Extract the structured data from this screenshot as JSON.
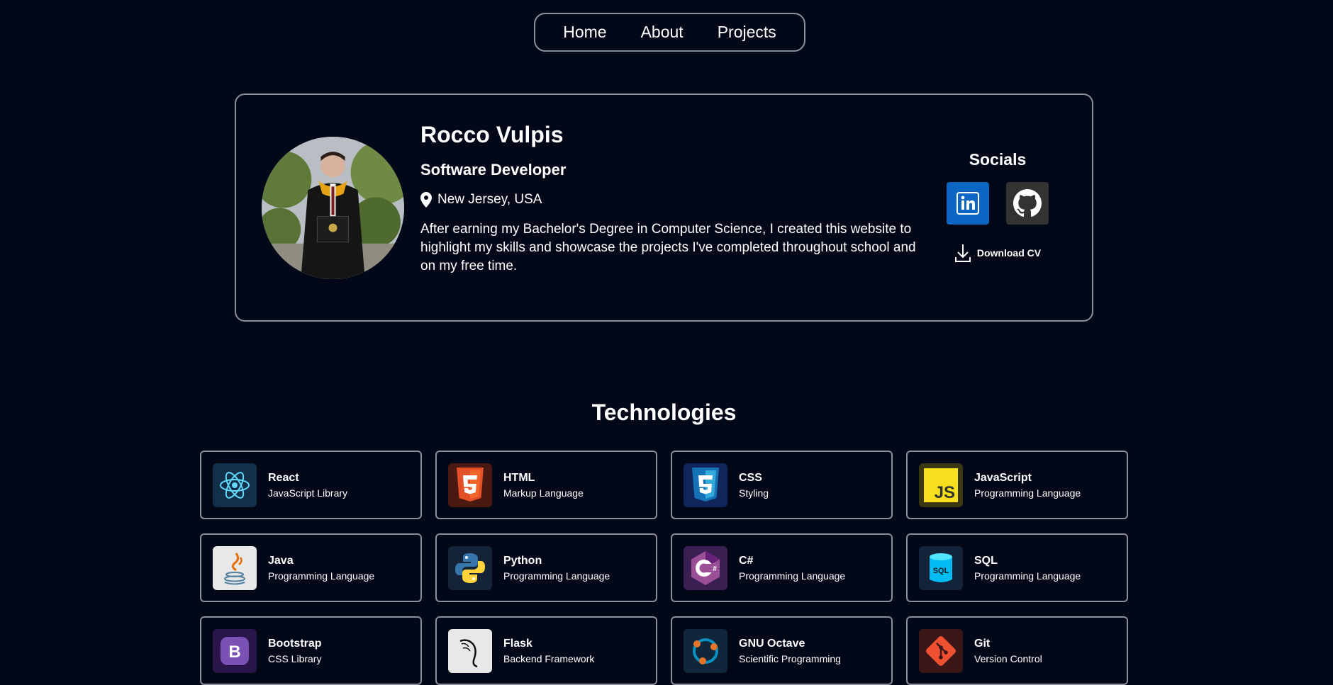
{
  "nav": {
    "items": [
      "Home",
      "About",
      "Projects"
    ]
  },
  "profile": {
    "name": "Rocco Vulpis",
    "role": "Software Developer",
    "location": "New Jersey, USA",
    "bio": "After earning my Bachelor's Degree in Computer Science, I created this website to highlight my skills and showcase the projects I've completed throughout school and on my free time.",
    "socials_title": "Socials",
    "download_label": "Download CV",
    "social_icons": [
      "linkedin-icon",
      "github-icon"
    ]
  },
  "technologies": {
    "title": "Technologies",
    "items": [
      {
        "name": "React",
        "desc": "JavaScript Library",
        "icon": "react-icon",
        "color": "#61dafb"
      },
      {
        "name": "HTML",
        "desc": "Markup Language",
        "icon": "html5-icon",
        "color": "#e34f26"
      },
      {
        "name": "CSS",
        "desc": "Styling",
        "icon": "css3-icon",
        "color": "#1572b6"
      },
      {
        "name": "JavaScript",
        "desc": "Programming Language",
        "icon": "javascript-icon",
        "color": "#f7df1e"
      },
      {
        "name": "Java",
        "desc": "Programming Language",
        "icon": "java-icon",
        "color": "#e76f00"
      },
      {
        "name": "Python",
        "desc": "Programming Language",
        "icon": "python-icon",
        "color": "#3776ab"
      },
      {
        "name": "C#",
        "desc": "Programming Language",
        "icon": "csharp-icon",
        "color": "#9b4f96"
      },
      {
        "name": "SQL",
        "desc": "Programming Language",
        "icon": "sql-icon",
        "color": "#00bcf2"
      },
      {
        "name": "Bootstrap",
        "desc": "CSS Library",
        "icon": "bootstrap-icon",
        "color": "#7952b3"
      },
      {
        "name": "Flask",
        "desc": "Backend Framework",
        "icon": "flask-icon",
        "color": "#000000"
      },
      {
        "name": "GNU Octave",
        "desc": "Scientific Programming",
        "icon": "octave-icon",
        "color": "#0790c0"
      },
      {
        "name": "Git",
        "desc": "Version Control",
        "icon": "git-icon",
        "color": "#f05032"
      }
    ]
  }
}
